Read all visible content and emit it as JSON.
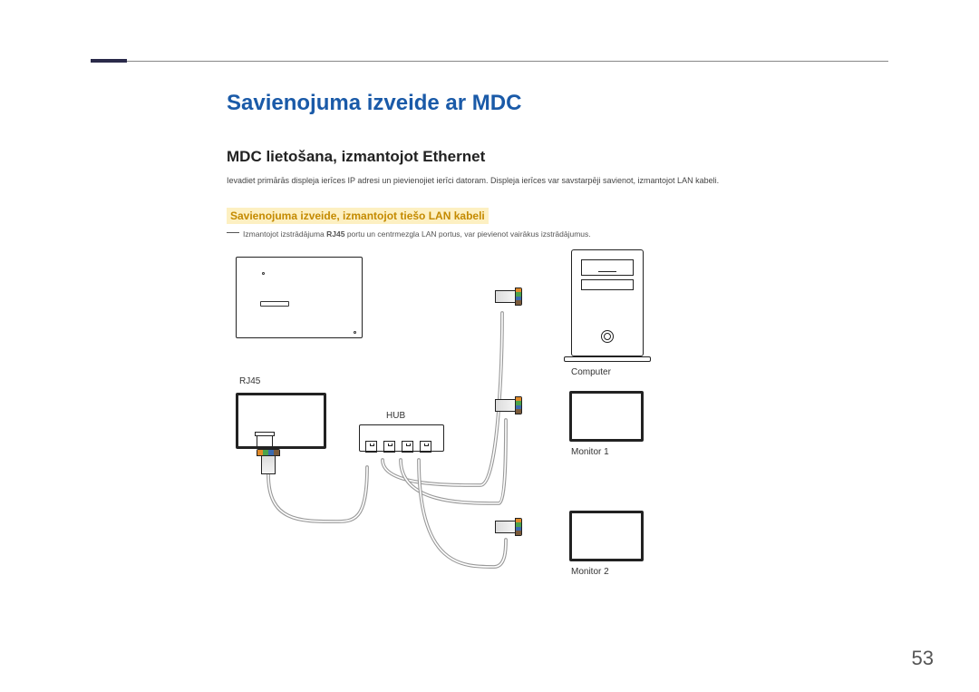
{
  "page": {
    "title": "Savienojuma izveide ar MDC",
    "subtitle": "MDC lietošana, izmantojot Ethernet",
    "body": "Ievadiet primārās displeja ierīces IP adresi un pievienojiet ierīci datoram. Displeja ierīces var savstarpēji savienot, izmantojot LAN kabeli.",
    "sub_heading": "Savienojuma izveide, izmantojot tiešo LAN kabeli",
    "note_prefix": "Izmantojot izstrādājuma ",
    "note_bold": "RJ45",
    "note_suffix": " portu un centrmezgla LAN portus, var pievienot vairākus izstrādājumus.",
    "page_number": "53"
  },
  "diagram": {
    "rj45_label": "RJ45",
    "hub_label": "HUB",
    "computer_label": "Computer",
    "monitor1_label": "Monitor 1",
    "monitor2_label": "Monitor 2"
  }
}
